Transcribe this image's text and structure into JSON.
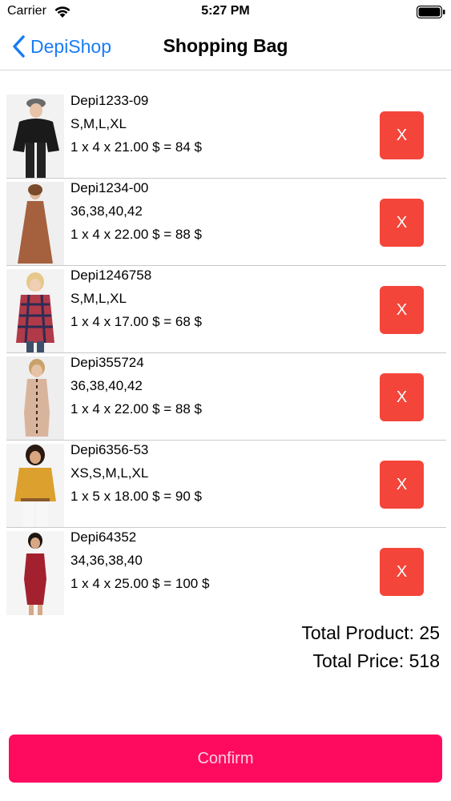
{
  "status_bar": {
    "carrier": "Carrier",
    "time": "5:27 PM"
  },
  "nav": {
    "back_label": "DepiShop",
    "title": "Shopping Bag"
  },
  "products": [
    {
      "code": "Depi1233-09",
      "sizes": "S,M,L,XL",
      "calc": "1 x 4 x 21.00 $ = 84 $",
      "remove_label": "X",
      "image": "woman-black-blouse-photo"
    },
    {
      "code": "Depi1234-00",
      "sizes": "36,38,40,42",
      "calc": "1 x 4 x 22.00 $ = 88 $",
      "remove_label": "X",
      "image": "woman-brown-maxi-dress-photo"
    },
    {
      "code": "Depi1246758",
      "sizes": "S,M,L,XL",
      "calc": "1 x 4 x 17.00 $ = 68 $",
      "remove_label": "X",
      "image": "woman-plaid-shirt-photo"
    },
    {
      "code": "Depi355724",
      "sizes": "36,38,40,42",
      "calc": "1 x 4 x 22.00 $ = 88 $",
      "remove_label": "X",
      "image": "woman-beige-dress-photo"
    },
    {
      "code": "Depi6356-53",
      "sizes": "XS,S,M,L,XL",
      "calc": "1 x 5 x 18.00 $ = 90 $",
      "remove_label": "X",
      "image": "woman-mustard-blouse-photo"
    },
    {
      "code": "Depi64352",
      "sizes": "34,36,38,40",
      "calc": "1 x 4 x 25.00 $ = 100 $",
      "remove_label": "X",
      "image": "woman-red-dress-photo"
    }
  ],
  "totals": {
    "product": "Total Product: 25",
    "price": "Total Price: 518"
  },
  "confirm_label": "Confirm",
  "colors": {
    "accent": "#1a7cf5",
    "remove": "#f4453a",
    "confirm": "#fe0b60"
  }
}
